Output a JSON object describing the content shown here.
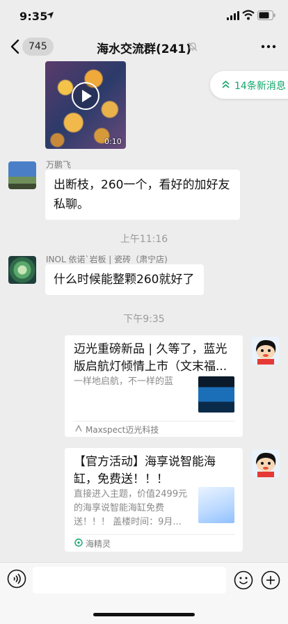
{
  "status": {
    "time": "9:35"
  },
  "header": {
    "back_count": "745",
    "title": "海水交流群(241)"
  },
  "video": {
    "duration": "0:10"
  },
  "new_messages": {
    "label": "14条新消息"
  },
  "messages": [
    {
      "sender": "万鹏飞",
      "text": "出断枝，260一个，看好的加好友私聊。"
    },
    {
      "sender": "INOL 依诺`岩板 | 瓷砖（肃宁店)",
      "text": "什么时候能整颗260就好了"
    }
  ],
  "timestamps": [
    "上午11:16",
    "下午9:35"
  ],
  "cards": [
    {
      "title": "迈光重磅新品 | 久等了，蓝光版启航灯倾情上市（文末福...",
      "desc": "一样地启航，不一样的蓝",
      "source": "Maxspect迈光科技"
    },
    {
      "title": "【官方活动】海享说智能海缸，免费送！！！",
      "desc": "直接进入主题，价值2499元的海享说智能海缸免费送！！！ 盖楼时间：9月...",
      "source": "海精灵"
    }
  ],
  "input": {
    "placeholder": ""
  },
  "colors": {
    "background": "#ededed",
    "bubble": "#ffffff",
    "accent": "#12a66a"
  }
}
